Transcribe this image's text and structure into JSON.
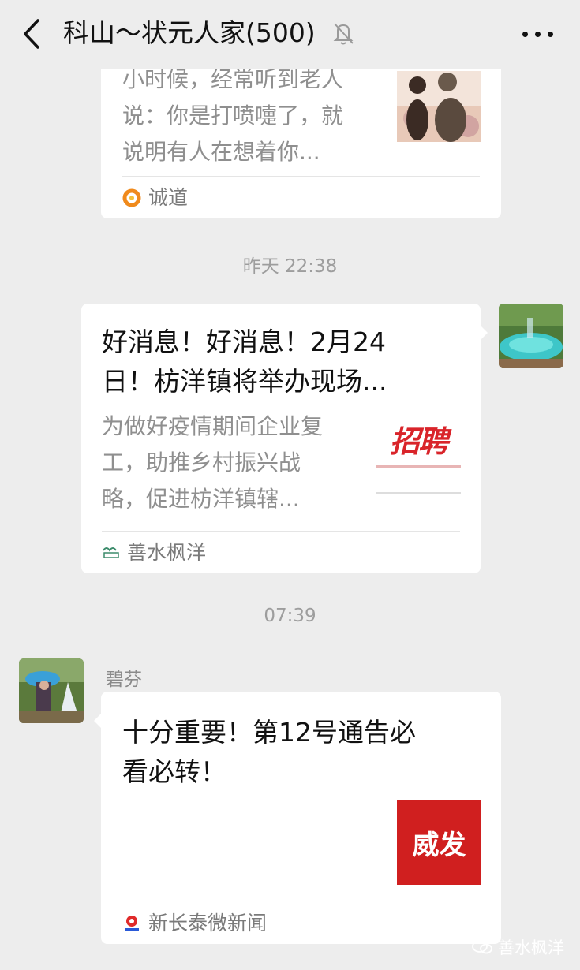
{
  "header": {
    "title": "科山～状元人家(500)"
  },
  "messages": {
    "first": {
      "desc_line1": "小时候，经常听到老人",
      "desc_line2": "说：你是打喷嚏了，就",
      "desc_line3": "说明有人在想着你...",
      "source": "诚道"
    },
    "time1": "昨天 22:38",
    "second": {
      "title_line1": "好消息！好消息！2月24",
      "title_line2": "日！枋洋镇将举办现场...",
      "desc_line1": "为做好疫情期间企业复",
      "desc_line2": "工，助推乡村振兴战",
      "desc_line3": "略，促进枋洋镇辖...",
      "thumb_text": "招聘",
      "source": "善水枫洋"
    },
    "time2": "07:39",
    "third": {
      "sender": "碧芬",
      "title_line1": "十分重要！第12号通告必",
      "title_line2": "看必转！",
      "thumb_text": "威发",
      "source": "新长泰微新闻"
    }
  },
  "watermark": {
    "text": "善水枫洋"
  },
  "colors": {
    "background": "#ededed",
    "card": "#ffffff",
    "thumb_red": "#d01f1f"
  }
}
